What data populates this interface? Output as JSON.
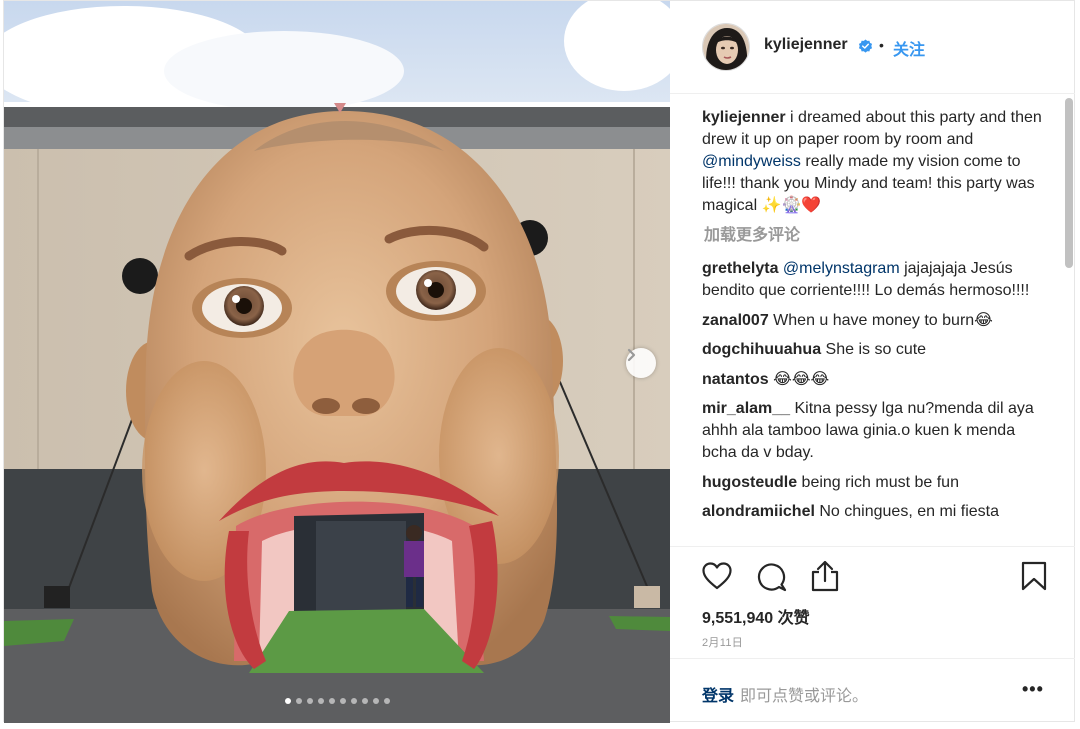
{
  "post": {
    "author": "kyliejenner",
    "follow_label": "关注",
    "bullet": "•",
    "caption": {
      "user": "kyliejenner",
      "text_1": " i dreamed about this party and then drew it up on paper room by room and ",
      "mention": "@mindyweiss",
      "text_2": " really made my vision come to life!!! thank you Mindy and team! this party was magical ✨🎡❤️"
    },
    "load_more": "加载更多评论",
    "comments": [
      {
        "user": "grethelyta",
        "mention": "@melynstagram",
        "text": " jajajajaja Jesús bendito que corriente!!!! Lo demás hermoso!!!!"
      },
      {
        "user": "zanal007",
        "mention": "",
        "text": " When u have money to burn😂"
      },
      {
        "user": "dogchihuuahua",
        "mention": "",
        "text": " She is so cute"
      },
      {
        "user": "natantos",
        "mention": "",
        "text": " 😂😂😂"
      },
      {
        "user": "mir_alam__",
        "mention": "",
        "text": " Kitna pessy lga nu?menda dil aya ahhh ala tamboo lawa ginia.o kuen k menda bcha da v bday."
      },
      {
        "user": "hugosteudle",
        "mention": "",
        "text": " being rich must be fun"
      },
      {
        "user": "alondramiichel",
        "mention": "",
        "text": " No chingues, en mi fiesta"
      }
    ],
    "likes": "9,551,940 次赞",
    "date": "2月11日",
    "login_label": "登录",
    "comment_prompt": "即可点赞或评论。",
    "more_label": "•••",
    "carousel": {
      "slides": 10,
      "active": 1
    },
    "icons": [
      "verified-badge-icon",
      "heart-icon",
      "comment-icon",
      "share-icon",
      "bookmark-icon",
      "chevron-right-icon",
      "more-options-icon"
    ],
    "colors": {
      "link": "#003569",
      "follow": "#3897f0",
      "muted": "#999999",
      "verified": "#3897f0"
    }
  }
}
